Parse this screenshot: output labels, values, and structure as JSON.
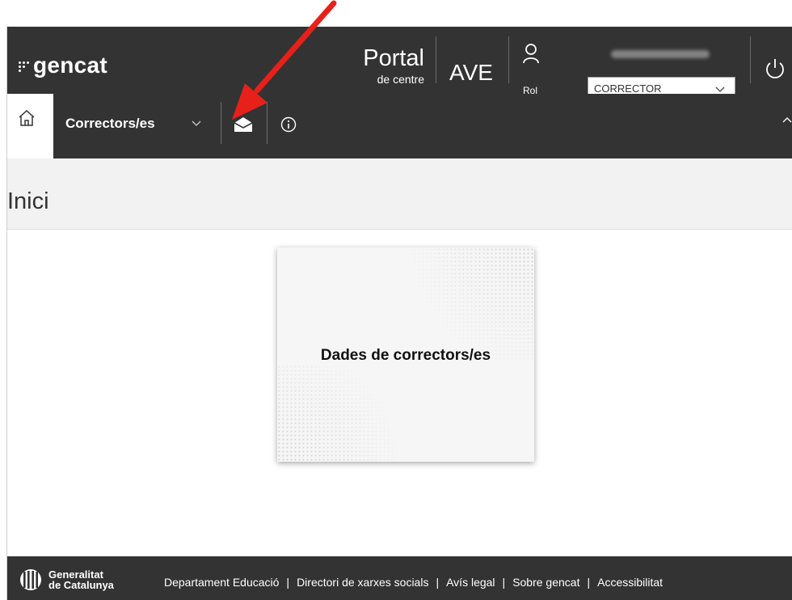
{
  "header": {
    "logo_text": "gencat",
    "portal_title": "Portal",
    "portal_subtitle": "de centre",
    "app_name": "AVE",
    "rol_label": "Rol",
    "rol_selected": "CORRECTOR"
  },
  "nav": {
    "menu_label": "Correctors/es"
  },
  "page": {
    "title": "Inici"
  },
  "card": {
    "title": "Dades de correctors/es"
  },
  "footer": {
    "org_line1": "Generalitat",
    "org_line2": "de Catalunya",
    "links": [
      "Departament Educació",
      "Directori de xarxes socials",
      "Avís legal",
      "Sobre gencat",
      "Accessibilitat"
    ]
  },
  "colors": {
    "header_bg": "#333333",
    "annotation_arrow": "#e8201a"
  },
  "icons": {
    "home": "home-icon",
    "mail": "envelope-icon",
    "info": "info-icon",
    "user": "user-icon",
    "power": "power-icon"
  }
}
